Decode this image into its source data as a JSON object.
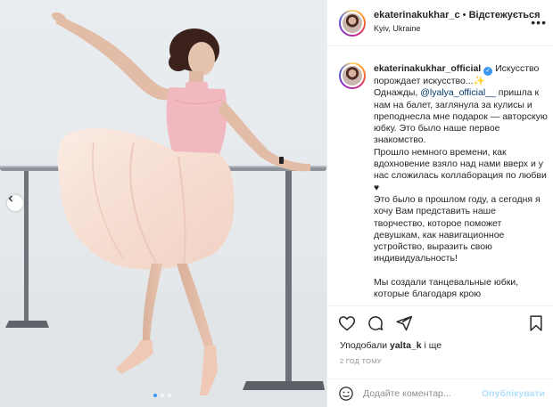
{
  "header": {
    "username": "ekaterinakukhar_c",
    "separator": " • ",
    "follow_label": "Відстежується",
    "location": "Kyiv, Ukraine",
    "more_label": "•••"
  },
  "caption": {
    "username": "ekaterinakukhar_official",
    "verified_glyph": "✓",
    "intro": " Искусство порождает искусство...✨",
    "p1_before": "Однажды, ",
    "p1_mention": "@lyalya_official__",
    "p1_after": " пришла к нам на балет, заглянула за кулисы и преподнесла мне подарок — авторскую юбку. Это было наше первое знакомство.",
    "p2": "Прошло немного времени, как вдохновение взяло над нами вверх и у нас сложилась коллаборация по любви ♥",
    "p3": "Это было в прошлом году, а сегодня я хочу Вам представить наше творчество, которое поможет девушкам, как навигационное устройство, выразить свою индивидуальность!",
    "p4": "Мы создали танцевальные юбки, которые благодаря крою"
  },
  "likes": {
    "prefix": "Уподобали ",
    "user": "yalta_k",
    "suffix": " і ще"
  },
  "timestamp": "2 ГОД ТОМУ",
  "comment": {
    "placeholder": "Додайте коментар...",
    "publish_label": "Опублікувати"
  },
  "carousel": {
    "total": 3,
    "active_index": 0
  },
  "colors": {
    "accent": "#3897f0",
    "publish_disabled": "#b2dffc",
    "leotard": "#f2b8c0",
    "skirt": "#f7e3d8"
  },
  "icons": {
    "like": "heart-icon",
    "comment": "comment-icon",
    "share": "share-icon",
    "save": "bookmark-icon",
    "emoji": "smile-icon",
    "prev": "chevron-left-icon"
  }
}
